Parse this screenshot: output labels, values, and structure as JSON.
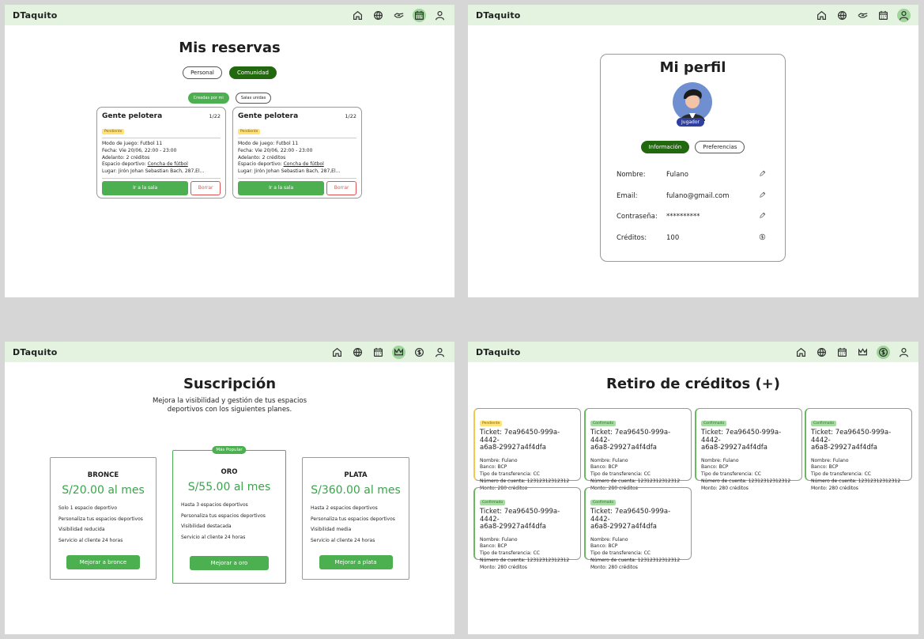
{
  "brand": "DTaquito",
  "reservas": {
    "title": "Mis reservas",
    "tabs": [
      "Personal",
      "Comunidad"
    ],
    "subtabs": [
      "Creadas por mi",
      "Salas unidas"
    ],
    "cards": [
      {
        "title": "Gente pelotera",
        "count": "1/22",
        "status": "Pendiente",
        "modo": "Modo de juego: Futbol 11",
        "fecha": "Fecha: Vie 20/06, 22:00 - 23:00",
        "adelanto": "Adelanto: 2 créditos",
        "espacio_prefix": "Espacio deportivo: ",
        "espacio_link": "Concha de fútbol",
        "lugar": "Lugar: Jirón Johan Sebastian Bach, 287,El...",
        "go": "Ir a la sala",
        "delete": "Borrar"
      },
      {
        "title": "Gente pelotera",
        "count": "1/22",
        "status": "Pendiente",
        "modo": "Modo de juego: Futbol 11",
        "fecha": "Fecha: Vie 20/06, 22:00 - 23:00",
        "adelanto": "Adelanto: 2 créditos",
        "espacio_prefix": "Espacio deportivo: ",
        "espacio_link": "Concha de fútbol",
        "lugar": "Lugar: Jirón Johan Sebastian Bach, 287,El...",
        "go": "Ir a la sala",
        "delete": "Borrar"
      }
    ]
  },
  "perfil": {
    "title": "Mi perfil",
    "role": "Jugador",
    "tabs": [
      "Información",
      "Preferencias"
    ],
    "rows": [
      {
        "label": "Nombre:",
        "value": "Fulano",
        "icon": "edit-icon"
      },
      {
        "label": "Email:",
        "value": "fulano@gmail.com",
        "icon": "edit-icon"
      },
      {
        "label": "Contraseña:",
        "value": "**********",
        "icon": "edit-icon"
      },
      {
        "label": "Créditos:",
        "value": "100",
        "icon": "coin-icon"
      }
    ]
  },
  "suscripcion": {
    "title": "Suscripción",
    "subtitle1": "Mejora la visibilidad y gestión de tus espacios",
    "subtitle2": "deportivos con los siguientes planes.",
    "plans": [
      {
        "name": "BRONCE",
        "price": "S/20.00 al mes",
        "features": [
          "Solo 1 espacio deportivo",
          "Personaliza tus espacios deportivos",
          "Visibilidad reducida",
          "Servicio al cliente 24 horas"
        ],
        "cta": "Mejorar a bronce"
      },
      {
        "name": "ORO",
        "price": "S/55.00 al mes",
        "popular": "Más Popular",
        "features": [
          "Hasta 3 espacios deportivos",
          "Personaliza tus espacios deportivos",
          "Visibilidad destacada",
          "Servicio al cliente 24 horas"
        ],
        "cta": "Mejorar a oro"
      },
      {
        "name": "PLATA",
        "price": "S/360.00 al mes",
        "features": [
          "Hasta 2 espacios deportivos",
          "Personaliza tus espacios deportivos",
          "Visibilidad media",
          "Servicio al cliente 24 horas"
        ],
        "cta": "Mejorar a plata"
      }
    ]
  },
  "retiro": {
    "title": "Retiro de créditos (+)",
    "tickets": [
      {
        "status": "Pendiente",
        "ticket1": "Ticket: 7ea96450-999a-4442-",
        "ticket2": "a6a8-29927a4f4dfa",
        "nombre": "Nombre: Fulano",
        "banco": "Banco: BCP",
        "tipo": "Tipo de transferencia: CC",
        "cuenta": "Número de cuenta: 12312312312312",
        "monto": "Monto: 280 créditos"
      },
      {
        "status": "Confirmado",
        "ticket1": "Ticket: 7ea96450-999a-4442-",
        "ticket2": "a6a8-29927a4f4dfa",
        "nombre": "Nombre: Fulano",
        "banco": "Banco: BCP",
        "tipo": "Tipo de transferencia: CC",
        "cuenta": "Número de cuenta: 12312312312312",
        "monto": "Monto: 280 créditos"
      },
      {
        "status": "Confirmado",
        "ticket1": "Ticket: 7ea96450-999a-4442-",
        "ticket2": "a6a8-29927a4f4dfa",
        "nombre": "Nombre: Fulano",
        "banco": "Banco: BCP",
        "tipo": "Tipo de transferencia: CC",
        "cuenta": "Número de cuenta: 12312312312312",
        "monto": "Monto: 280 créditos"
      },
      {
        "status": "Confirmado",
        "ticket1": "Ticket: 7ea96450-999a-4442-",
        "ticket2": "a6a8-29927a4f4dfa",
        "nombre": "Nombre: Fulano",
        "banco": "Banco: BCP",
        "tipo": "Tipo de transferencia: CC",
        "cuenta": "Número de cuenta: 12312312312312",
        "monto": "Monto: 280 créditos"
      },
      {
        "status": "Confirmado",
        "ticket1": "Ticket: 7ea96450-999a-4442-",
        "ticket2": "a6a8-29927a4f4dfa",
        "nombre": "Nombre: Fulano",
        "banco": "Banco: BCP",
        "tipo": "Tipo de transferencia: CC",
        "cuenta": "Número de cuenta: 12312312312312",
        "monto": "Monto: 280 créditos"
      },
      {
        "status": "Confirmado",
        "ticket1": "Ticket: 7ea96450-999a-4442-",
        "ticket2": "a6a8-29927a4f4dfa",
        "nombre": "Nombre: Fulano",
        "banco": "Banco: BCP",
        "tipo": "Tipo de transferencia: CC",
        "cuenta": "Número de cuenta: 12312312312312",
        "monto": "Monto: 280 créditos"
      }
    ]
  },
  "colors": {
    "accent": "#4caf50",
    "dark_green": "#22680f",
    "topbar": "#e3f3e0",
    "danger": "#e05353"
  }
}
